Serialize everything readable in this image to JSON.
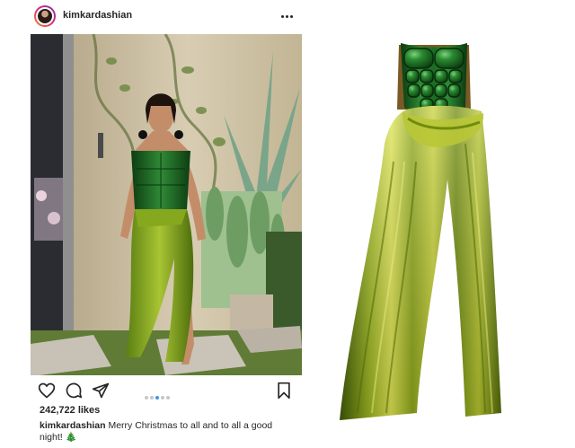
{
  "post": {
    "username": "kimkardashian",
    "likes": "242,722 likes",
    "caption_username": "kimkardashian",
    "caption_text": " Merry Christmas to all and to all a good night! 🎄",
    "carousel": {
      "count": 5,
      "active_index": 3
    },
    "icons": {
      "more": "more-options-icon",
      "like": "heart-icon",
      "comment": "comment-icon",
      "share": "send-icon",
      "save": "bookmark-icon"
    }
  },
  "dress_colors": {
    "bodice": "#1f6b22",
    "skirt_light": "#c9d33a",
    "skirt_dark": "#4f6a08"
  }
}
